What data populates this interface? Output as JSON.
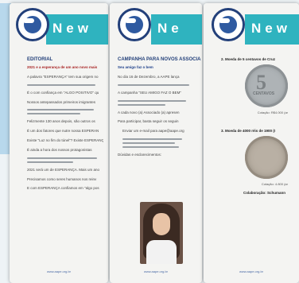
{
  "panels": [
    {
      "header_title": "New",
      "section_title": "EDITORIAL",
      "paragraphs": [
        "2021 e a esperança de um ano novo mais",
        "A palavra \"ESPERANÇA\" tem sua origem no",
        "É o com confiança em \"ALGO POSITIVO\" qu",
        "Nossos antepassados primeiros imigrantes",
        "Felizmente 130 anos depois, são outros os",
        "É um dos fatores que nutre nossa ESPERAN",
        "Existe \"Luz no fim do túnel\"? Existe ESPERANÇ",
        "É ainda a hora dos nossos protagonistas",
        "2021 será um de ESPERANÇA. Mais um ano",
        "Precisamos como seres humanos nos reinv",
        "E com ESPERANÇA confiamos em \"algo pos"
      ],
      "footer": "www.aape.org.br"
    },
    {
      "header_title": "Ne",
      "section_title": "CAMPANHA PARA NOVOS ASSOCIA",
      "greeting": "Seu amigo faz o bem",
      "paragraphs": [
        "No dia 16 de Dezembro, a AAPE lança",
        "A campanha \"SEU AMIGO FAZ O BEM\"",
        "A cada novo (a) Associado (a) apresen",
        "Para participar, basta seguir os seguin",
        "Enviar um e-mail para aape@aape.org",
        "Dúvidas e esclarecimentos:"
      ],
      "footer": "www.aape.org.br"
    },
    {
      "header_title": "New",
      "coin_captions": [
        "2.   Moeda de 5 centavos de Cruz",
        "3.   Moeda de 4000 réis de 1900 (I"
      ],
      "coin_numeral": "5",
      "coin_word": "CENTAVOS",
      "credits": [
        "Cotação: R$4.000 (ar",
        "Cotação: 4.800 (ar"
      ],
      "collab": "Colaboração: Schumann",
      "footer": "www.aape.org.br"
    }
  ],
  "colors": {
    "teal": "#2fb3bf",
    "navy": "#23407a",
    "red": "#a61f1f"
  }
}
